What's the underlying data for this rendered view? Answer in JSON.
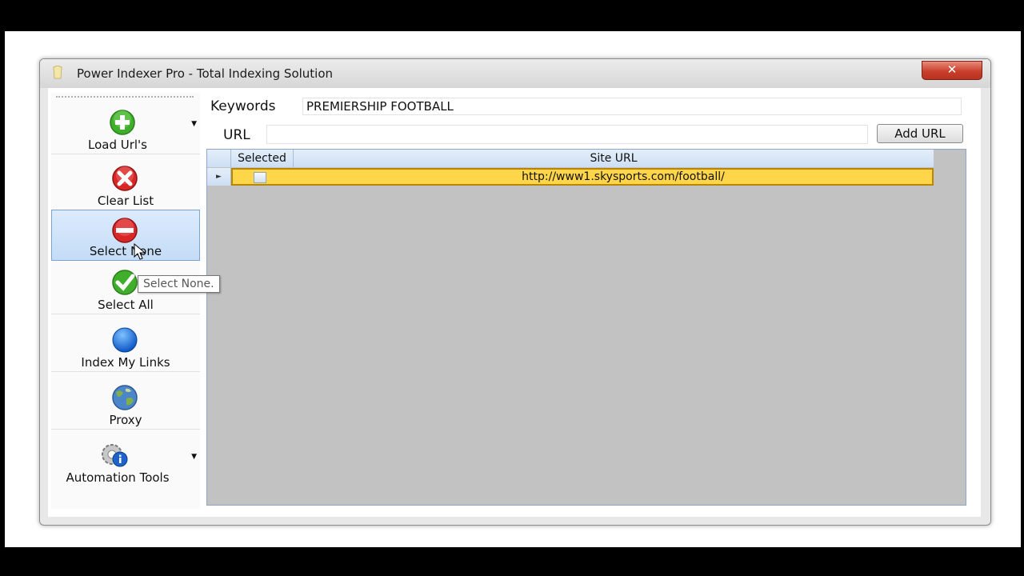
{
  "window": {
    "title": "Power Indexer Pro - Total Indexing Solution",
    "close_label": "✕"
  },
  "toolbar": {
    "items": [
      {
        "label": "Load Url's",
        "icon": "add-icon"
      },
      {
        "label": "Clear List",
        "icon": "clear-icon"
      },
      {
        "label": "Select None",
        "icon": "select-none-icon"
      },
      {
        "label": "Select All",
        "icon": "check-icon"
      },
      {
        "label": "Index My Links",
        "icon": "globe-icon"
      },
      {
        "label": "Proxy",
        "icon": "earth-icon"
      },
      {
        "label": "Automation Tools",
        "icon": "gear-info-icon"
      }
    ],
    "tooltip": "Select None."
  },
  "form": {
    "keywords_label": "Keywords",
    "keywords_value": "PREMIERSHIP FOOTBALL",
    "url_label": "URL",
    "url_value": "",
    "add_button": "Add URL"
  },
  "grid": {
    "columns": [
      "Selected",
      "Site URL"
    ],
    "rows": [
      {
        "selected": false,
        "url": "http://www1.skysports.com/football/"
      }
    ]
  },
  "colors": {
    "selected_row": "#ffd64a",
    "grid_background": "#c2c2c2",
    "hover_accent": "#c4dcf7"
  }
}
